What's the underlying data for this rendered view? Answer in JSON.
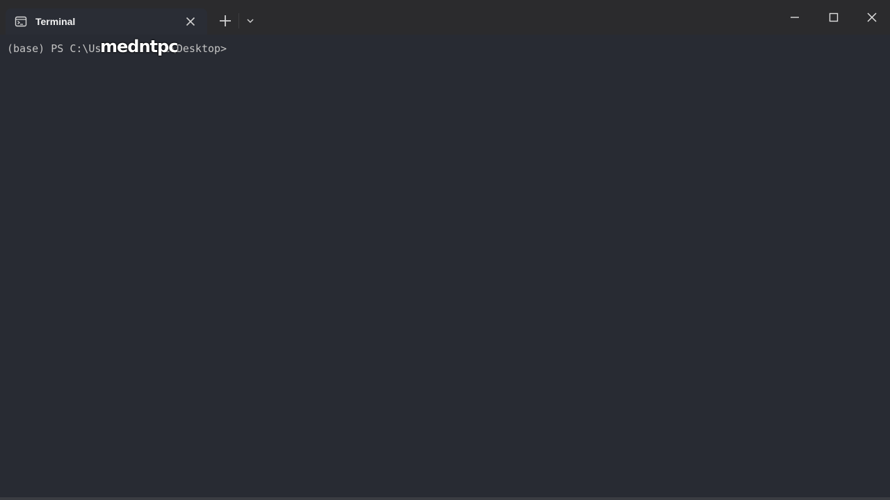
{
  "window": {
    "tab_title": "Terminal",
    "icons": {
      "tab": "terminal-icon",
      "tab_close": "close-icon",
      "new_tab": "plus-icon",
      "dropdown": "chevron-down-icon",
      "minimize": "minimize-icon",
      "maximize": "maximize-icon",
      "close": "close-icon"
    }
  },
  "terminal": {
    "prompt_env": "(base)",
    "prompt_shell": "PS",
    "prompt_path_start": "C:\\Us",
    "prompt_path_end": "e\\Desktop>",
    "caption_overlay": "medntpc"
  },
  "colors": {
    "background": "#282b33",
    "titlebar": "#2b2b2d",
    "text": "#c4c4c4",
    "caption": "#ffffff"
  }
}
